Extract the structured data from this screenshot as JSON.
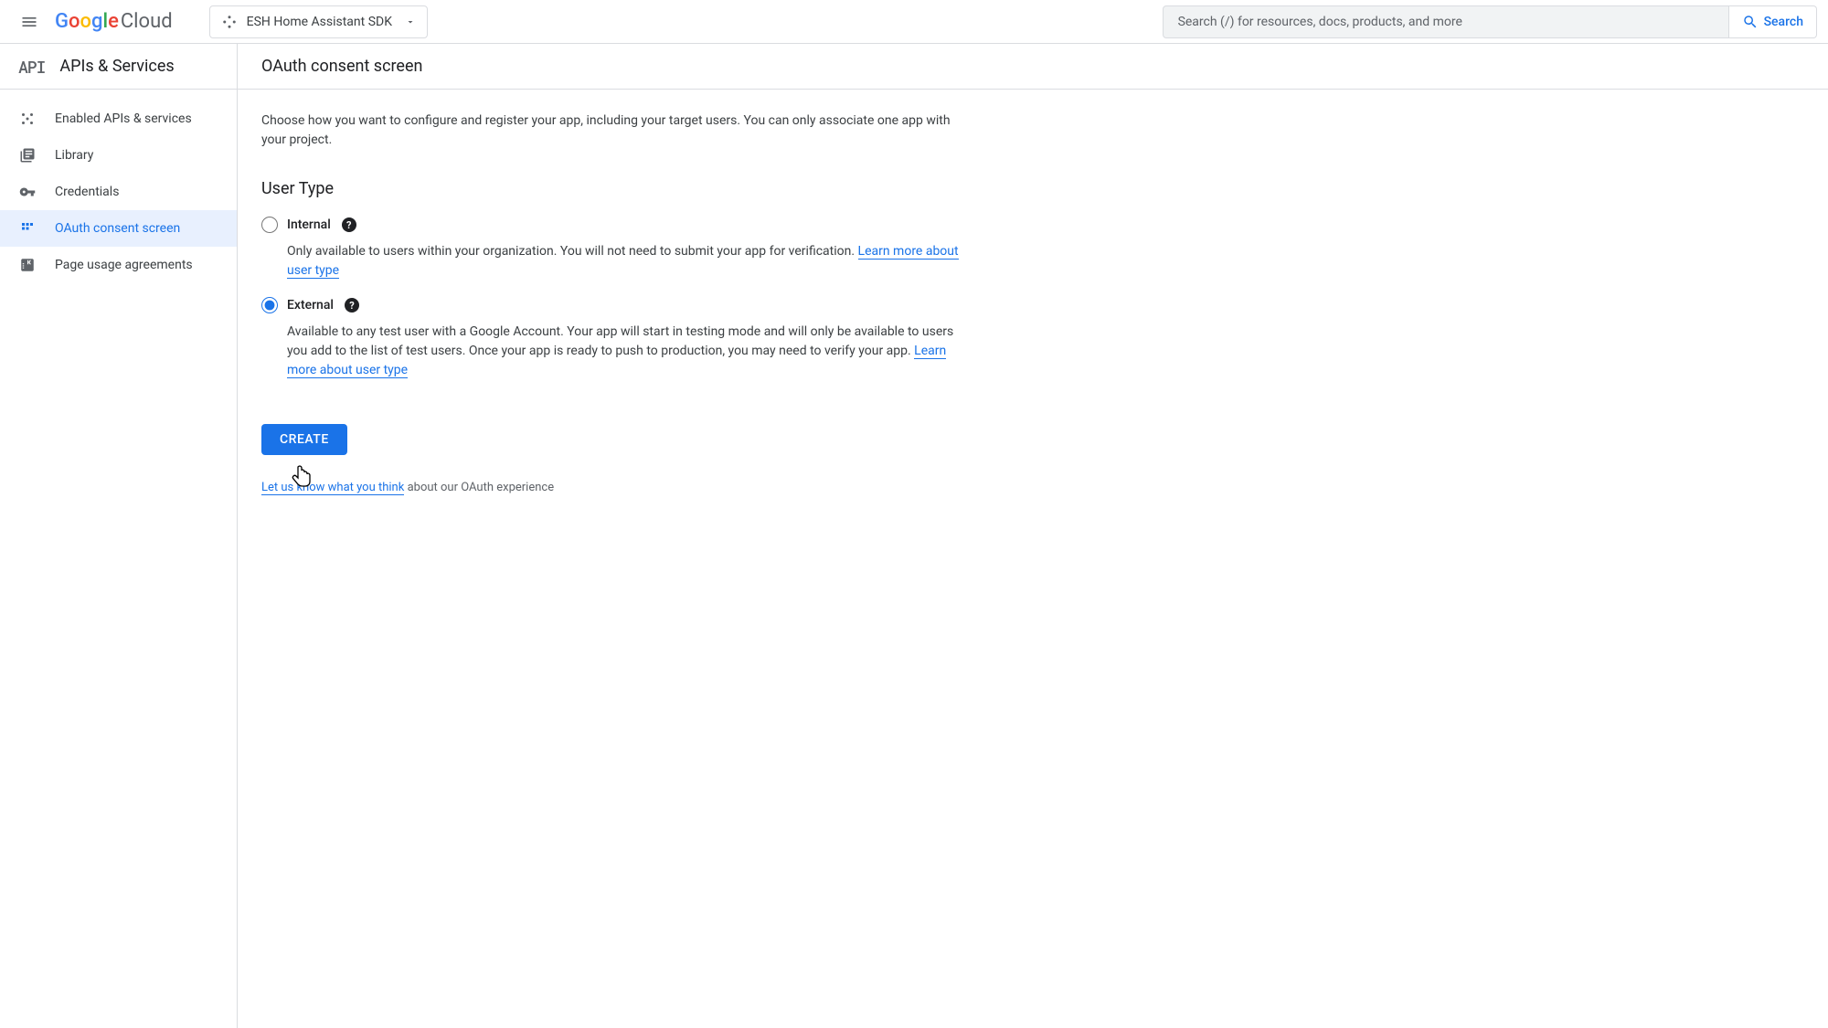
{
  "header": {
    "logo_cloud": "Cloud",
    "project_name": "ESH Home Assistant SDK",
    "search_placeholder": "Search (/) for resources, docs, products, and more",
    "search_button": "Search"
  },
  "sidebar": {
    "title": "APIs & Services",
    "items": [
      {
        "label": "Enabled APIs & services"
      },
      {
        "label": "Library"
      },
      {
        "label": "Credentials"
      },
      {
        "label": "OAuth consent screen"
      },
      {
        "label": "Page usage agreements"
      }
    ]
  },
  "main": {
    "title": "OAuth consent screen",
    "intro": "Choose how you want to configure and register your app, including your target users. You can only associate one app with your project.",
    "section_title": "User Type",
    "internal": {
      "label": "Internal",
      "description": "Only available to users within your organization. You will not need to submit your app for verification. ",
      "learn_more": "Learn more about user type"
    },
    "external": {
      "label": "External",
      "description": "Available to any test user with a Google Account. Your app will start in testing mode and will only be available to users you add to the list of test users. Once your app is ready to push to production, you may need to verify your app. ",
      "learn_more": "Learn more about user type"
    },
    "create_button": "CREATE",
    "feedback_link": "Let us know what you think",
    "feedback_text": " about our OAuth experience"
  }
}
